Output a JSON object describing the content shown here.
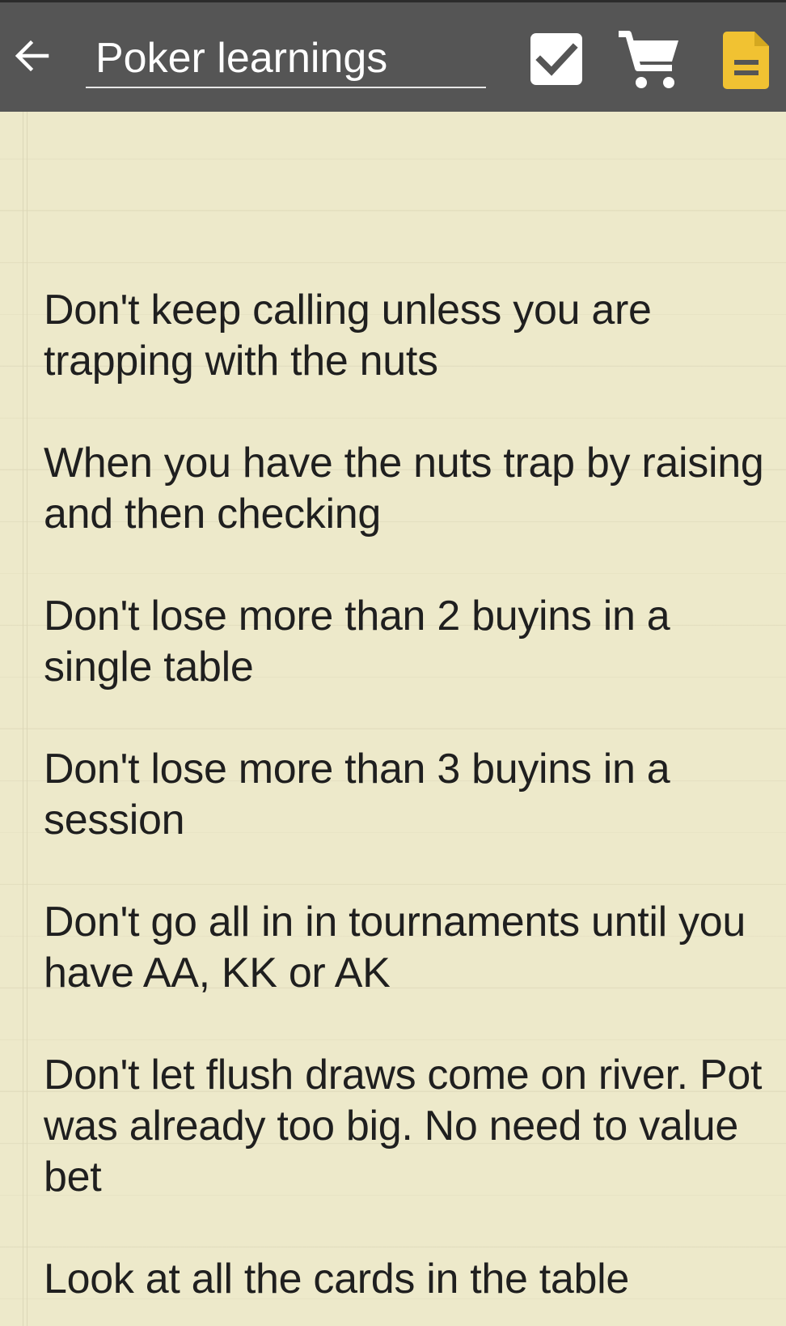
{
  "toolbar": {
    "title": "Poker learnings",
    "back_icon": "arrow-left-icon",
    "checklist_icon": "checkbox-icon",
    "cart_icon": "shopping-cart-icon",
    "doc_icon": "document-icon",
    "accent_color": "#f1c232",
    "bar_color": "#555555"
  },
  "note": {
    "paper_color": "#ede9ca",
    "items": [
      "Don't keep calling unless you are trapping with the nuts",
      "When you have the nuts trap by raising and then checking",
      "Don't lose more than 2 buyins in a single table",
      "Don't lose more than 3 buyins in a session",
      "Don't go all in in tournaments until you have AA, KK or AK",
      "Don't let flush draws come on river. Pot was already too big. No need to value bet",
      "Look at all the cards in the table"
    ]
  }
}
